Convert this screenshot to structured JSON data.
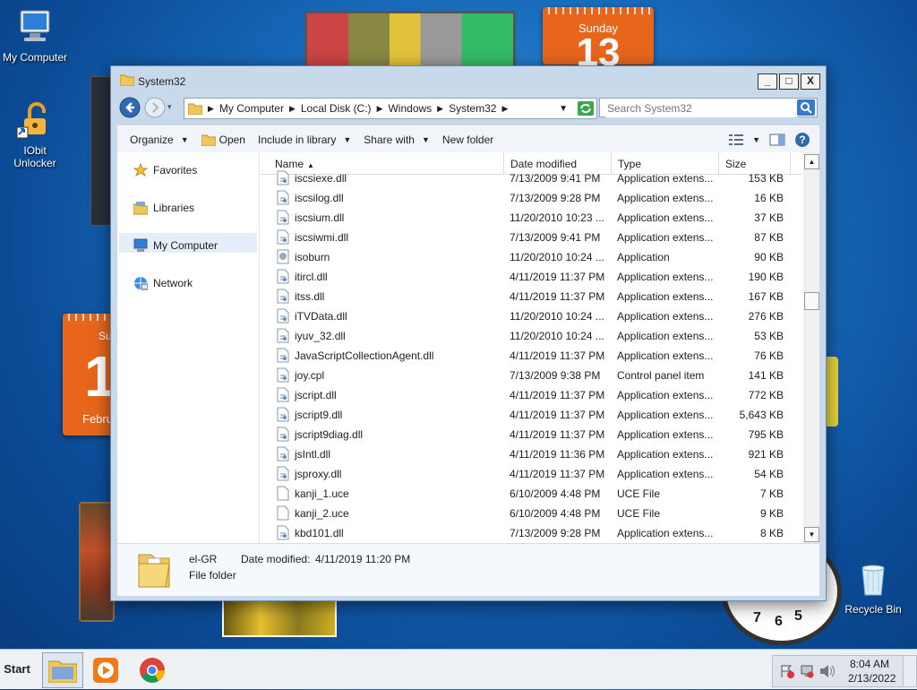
{
  "desktop": {
    "icons": [
      {
        "label": "My Computer"
      },
      {
        "label": "IObit Unlocker"
      },
      {
        "label": "Recycle Bin"
      }
    ],
    "gadgets": {
      "calendar_top": {
        "day_name": "Sunday",
        "day_number": "13"
      },
      "calendar_left": {
        "day_number": "1",
        "day_name": "Su",
        "month": "Febru"
      },
      "clock_numbers": [
        "7",
        "6",
        "5"
      ]
    }
  },
  "window": {
    "title": "System32",
    "controls": {
      "minimize": "_",
      "maximize": "□",
      "close": "X"
    },
    "breadcrumb": [
      "My Computer",
      "Local Disk (C:)",
      "Windows",
      "System32"
    ],
    "search": {
      "placeholder": "Search System32"
    },
    "commands": {
      "organize": "Organize",
      "open": "Open",
      "include_in_library": "Include in library",
      "share_with": "Share with",
      "new_folder": "New folder"
    },
    "nav_pane": [
      {
        "label": "Favorites",
        "icon": "star-icon"
      },
      {
        "label": "Libraries",
        "icon": "library-icon"
      },
      {
        "label": "My Computer",
        "icon": "computer-icon",
        "selected": true
      },
      {
        "label": "Network",
        "icon": "network-icon"
      }
    ],
    "columns": {
      "name": "Name",
      "date": "Date modified",
      "type": "Type",
      "size": "Size"
    },
    "files": [
      {
        "name": "iscsiexe.dll",
        "date": "7/13/2009 9:41 PM",
        "type": "Application extens...",
        "size": "153 KB"
      },
      {
        "name": "iscsilog.dll",
        "date": "7/13/2009 9:28 PM",
        "type": "Application extens...",
        "size": "16 KB"
      },
      {
        "name": "iscsium.dll",
        "date": "11/20/2010 10:23 ...",
        "type": "Application extens...",
        "size": "37 KB"
      },
      {
        "name": "iscsiwmi.dll",
        "date": "7/13/2009 9:41 PM",
        "type": "Application extens...",
        "size": "87 KB"
      },
      {
        "name": "isoburn",
        "date": "11/20/2010 10:24 ...",
        "type": "Application",
        "size": "90 KB"
      },
      {
        "name": "itircl.dll",
        "date": "4/11/2019 11:37 PM",
        "type": "Application extens...",
        "size": "190 KB"
      },
      {
        "name": "itss.dll",
        "date": "4/11/2019 11:37 PM",
        "type": "Application extens...",
        "size": "167 KB"
      },
      {
        "name": "iTVData.dll",
        "date": "11/20/2010 10:24 ...",
        "type": "Application extens...",
        "size": "276 KB"
      },
      {
        "name": "iyuv_32.dll",
        "date": "11/20/2010 10:24 ...",
        "type": "Application extens...",
        "size": "53 KB"
      },
      {
        "name": "JavaScriptCollectionAgent.dll",
        "date": "4/11/2019 11:37 PM",
        "type": "Application extens...",
        "size": "76 KB"
      },
      {
        "name": "joy.cpl",
        "date": "7/13/2009 9:38 PM",
        "type": "Control panel item",
        "size": "141 KB"
      },
      {
        "name": "jscript.dll",
        "date": "4/11/2019 11:37 PM",
        "type": "Application extens...",
        "size": "772 KB"
      },
      {
        "name": "jscript9.dll",
        "date": "4/11/2019 11:37 PM",
        "type": "Application extens...",
        "size": "5,643 KB"
      },
      {
        "name": "jscript9diag.dll",
        "date": "4/11/2019 11:37 PM",
        "type": "Application extens...",
        "size": "795 KB"
      },
      {
        "name": "jsIntl.dll",
        "date": "4/11/2019 11:36 PM",
        "type": "Application extens...",
        "size": "921 KB"
      },
      {
        "name": "jsproxy.dll",
        "date": "4/11/2019 11:37 PM",
        "type": "Application extens...",
        "size": "54 KB"
      },
      {
        "name": "kanji_1.uce",
        "date": "6/10/2009 4:48 PM",
        "type": "UCE File",
        "size": "7 KB"
      },
      {
        "name": "kanji_2.uce",
        "date": "6/10/2009 4:48 PM",
        "type": "UCE File",
        "size": "9 KB"
      },
      {
        "name": "kbd101.dll",
        "date": "7/13/2009 9:28 PM",
        "type": "Application extens...",
        "size": "8 KB"
      }
    ],
    "details_pane": {
      "name": "el-GR",
      "date_label": "Date modified:",
      "date_value": "4/11/2019 11:20 PM",
      "kind": "File folder"
    }
  },
  "taskbar": {
    "start": "Start",
    "apps": [
      "explorer-icon",
      "media-player-icon",
      "chrome-icon"
    ],
    "clock": {
      "time": "8:04 AM",
      "date": "2/13/2022"
    }
  },
  "colors": {
    "accent": "#3a8ee6",
    "window_frame": "#c9d9ec",
    "selection": "#e5eef9"
  }
}
